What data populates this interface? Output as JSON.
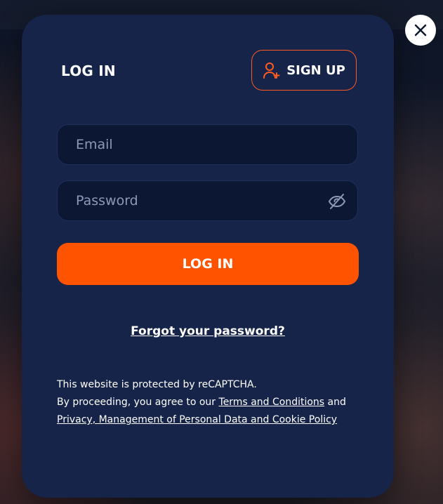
{
  "modal": {
    "title": "LOG IN",
    "signup_label": "SIGN UP",
    "email": {
      "placeholder": "Email",
      "value": ""
    },
    "password": {
      "placeholder": "Password",
      "value": ""
    },
    "login_label": "LOG IN",
    "forgot_label": "Forgot your password?",
    "legal": {
      "line1": "This website is protected by reCAPTCHA.",
      "line2_prefix": "By proceeding, you agree to our ",
      "terms_label": "Terms and Conditions",
      "line2_mid": " and",
      "privacy_label": "Privacy, Management of Personal Data and Cookie Policy"
    }
  },
  "icons": {
    "close": "close-icon",
    "signup": "user-plus-icon",
    "password_toggle": "eye-off-icon"
  },
  "colors": {
    "modal_bg": "#16244a",
    "field_bg": "#0b1733",
    "accent": "#ff5300",
    "text": "#ffffff",
    "placeholder": "#8d9ab7"
  }
}
